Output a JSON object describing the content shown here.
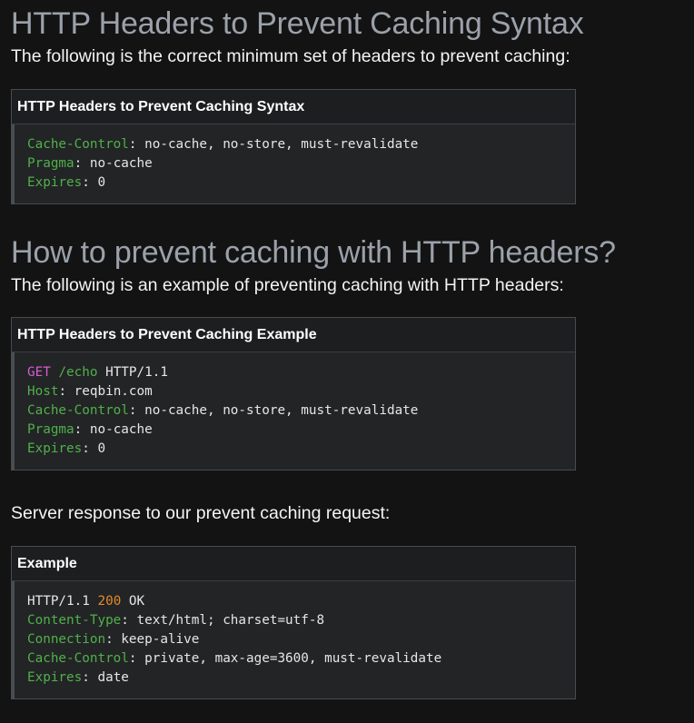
{
  "section1": {
    "title": "HTTP Headers to Prevent Caching Syntax",
    "lead": "The following is the correct minimum set of headers to prevent caching:",
    "box_title": "HTTP Headers to Prevent Caching Syntax",
    "lines": [
      {
        "key": "Cache-Control",
        "sep": ": ",
        "value": "no-cache, no-store, must-revalidate"
      },
      {
        "key": "Pragma",
        "sep": ": ",
        "value": "no-cache"
      },
      {
        "key": "Expires",
        "sep": ": ",
        "value": "0"
      }
    ]
  },
  "section2": {
    "title": "How to prevent caching with HTTP headers?",
    "lead": "The following is an example of preventing caching with HTTP headers:",
    "box_title": "HTTP Headers to Prevent Caching Example",
    "request_line": {
      "method": "GET",
      "path": "/echo",
      "protocol": "HTTP/1.1"
    },
    "lines": [
      {
        "key": "Host",
        "sep": ": ",
        "value": "reqbin.com"
      },
      {
        "key": "Cache-Control",
        "sep": ": ",
        "value": "no-cache, no-store, must-revalidate"
      },
      {
        "key": "Pragma",
        "sep": ": ",
        "value": "no-cache"
      },
      {
        "key": "Expires",
        "sep": ": ",
        "value": "0"
      }
    ]
  },
  "section3": {
    "lead": "Server response to our prevent caching request:",
    "box_title": "Example",
    "status_line": {
      "protocol": "HTTP/1.1",
      "code": "200",
      "text": "OK"
    },
    "lines": [
      {
        "key": "Content-Type",
        "sep": ": ",
        "value": "text/html; charset=utf-8"
      },
      {
        "key": "Connection",
        "sep": ": ",
        "value": "keep-alive"
      },
      {
        "key": "Cache-Control",
        "sep": ": ",
        "value": "private, max-age=3600, must-revalidate"
      },
      {
        "key": "Expires",
        "sep": ": ",
        "value": "date"
      }
    ]
  },
  "colors": {
    "background": "#131313",
    "heading": "#9aa1aa",
    "header_key": "#4fb14a",
    "http_method": "#d65cd0",
    "status_code": "#e28a2a"
  }
}
